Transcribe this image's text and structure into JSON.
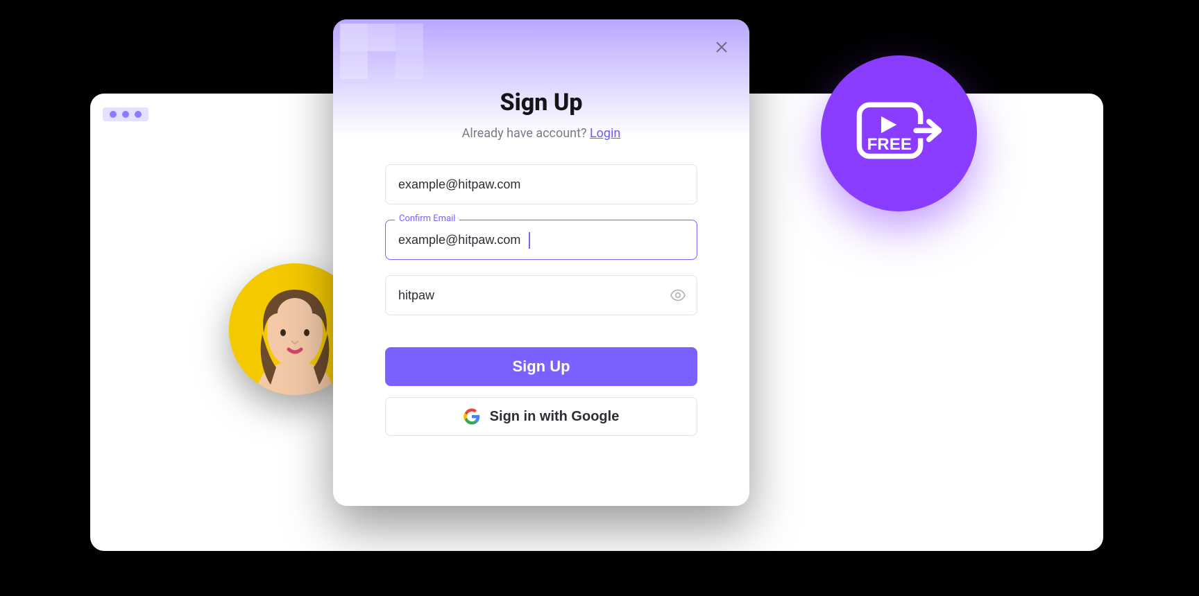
{
  "modal": {
    "title": "Sign Up",
    "already_text": "Already have account? ",
    "login_link": "Login",
    "email": {
      "value": "example@hitpaw.com"
    },
    "confirm_email": {
      "label": "Confirm Email",
      "value": "example@hitpaw.com"
    },
    "password": {
      "value": "hitpaw"
    },
    "submit_label": "Sign Up",
    "google_label": "Sign in with Google"
  },
  "badge": {
    "text": "FREE"
  },
  "colors": {
    "accent": "#7b61ff",
    "badge": "#8b3dff",
    "avatar_bg": "#f4c900"
  }
}
